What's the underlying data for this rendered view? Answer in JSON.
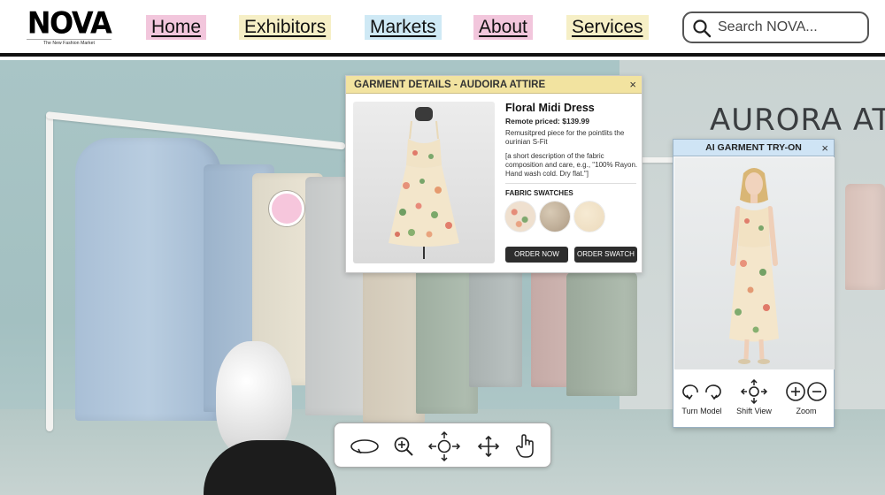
{
  "brand": {
    "name": "NOVA",
    "tagline": "The New Fashion Market"
  },
  "nav": [
    {
      "label": "Home",
      "color": "#f2c6dc"
    },
    {
      "label": "Exhibitors",
      "color": "#f6efc6"
    },
    {
      "label": "Markets",
      "color": "#cfe9f5"
    },
    {
      "label": "About",
      "color": "#f2c6dc"
    },
    {
      "label": "Services",
      "color": "#f6efc6"
    }
  ],
  "search": {
    "placeholder": "Search NOVA...",
    "icon": "search-icon"
  },
  "scene": {
    "sign": "AURORA ATT"
  },
  "details": {
    "title": "GARMENT DETAILS - AUDOIRA ATTIRE",
    "close": "×",
    "name": "Floral Midi Dress",
    "price": "Remote priced: $139.99",
    "description": "Remusitpred piece for the pointlits the ourinian S-Fit",
    "fabric": "[a short description of the fabric composition and care, e.g., \"100% Rayon. Hand wash cold. Dry flat.\"]",
    "swatches_label": "FABRIC SWATCHES",
    "swatch_colors": [
      "#efe0cf",
      "#bfae98",
      "#efdfc3"
    ],
    "order_now": "ORDER NOW",
    "order_swatch": "ORDER SWATCH"
  },
  "tryon": {
    "title": "AI GARMENT TRY-ON",
    "close": "×",
    "controls": [
      {
        "label": "Turn Model",
        "icon": "rotate-icon"
      },
      {
        "label": "Shift View",
        "icon": "move-arrows-icon"
      },
      {
        "label": "Zoom",
        "icon": "zoom-plus-minus-icon"
      }
    ]
  },
  "toolbar": {
    "tools": [
      "orbit-icon",
      "zoom-in-icon",
      "pan-icon",
      "move-icon",
      "hand-pointer-icon"
    ]
  },
  "colors": {
    "accent_pink": "#f6c6dc",
    "panel_header_yellow": "#f2e3a0",
    "panel_header_blue": "#cfe4f5",
    "button_dark": "#2d2d2d"
  }
}
